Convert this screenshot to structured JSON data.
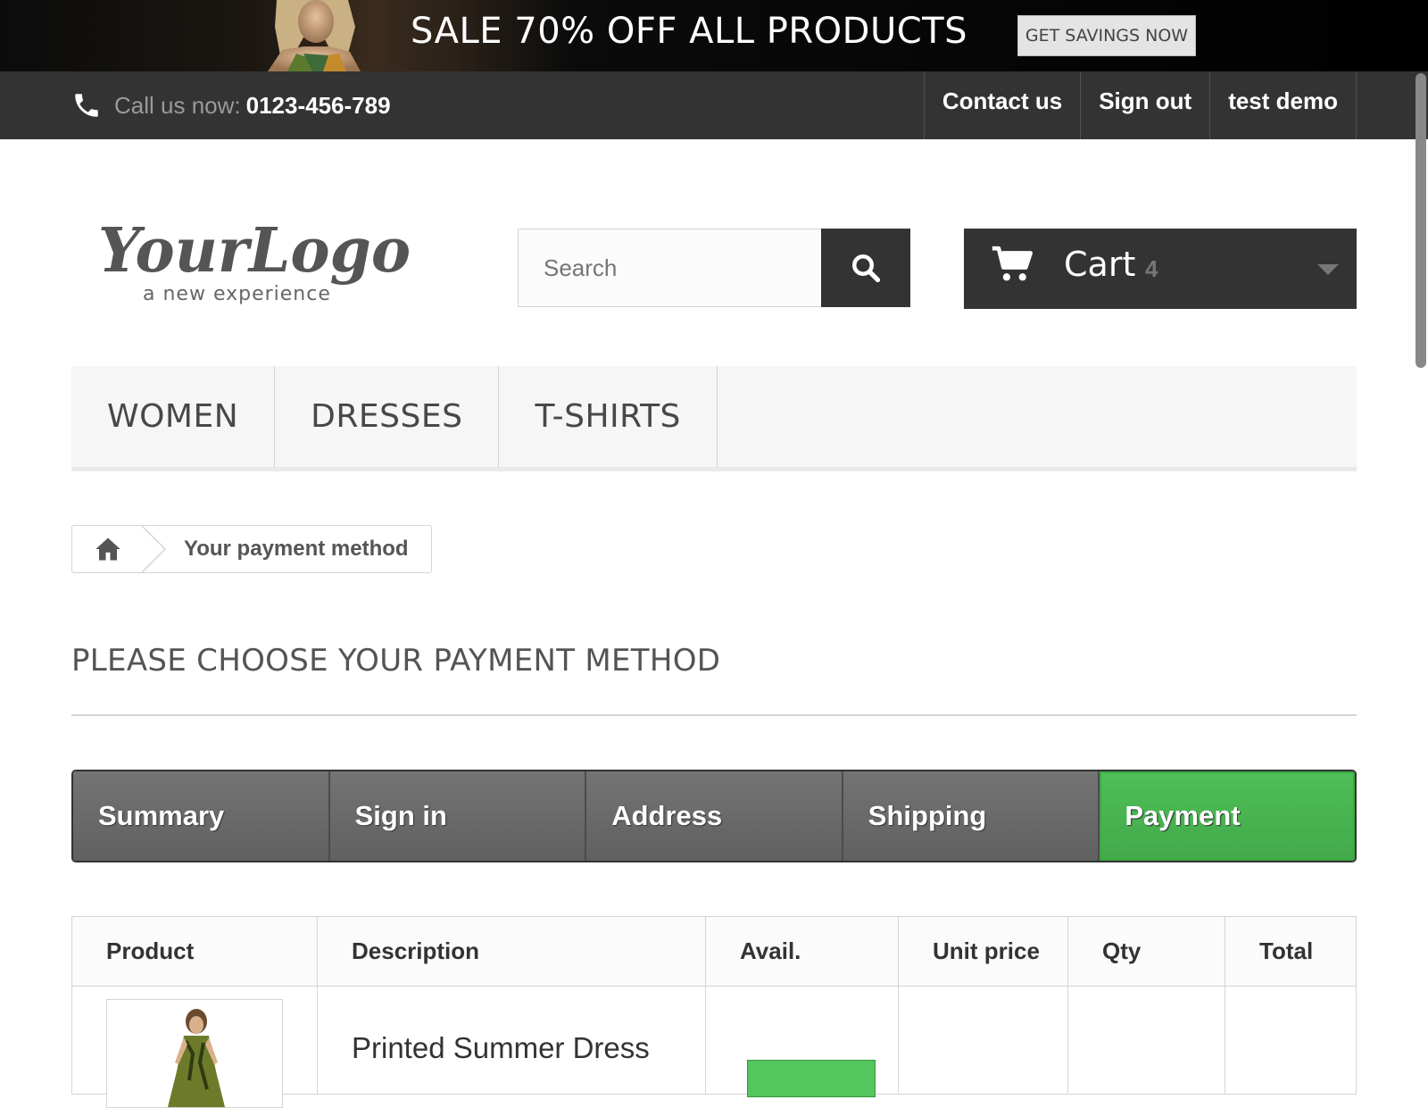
{
  "promo": {
    "headline": "SALE 70% OFF ALL PRODUCTS",
    "button_label": "GET SAVINGS NOW"
  },
  "topbar": {
    "phone_label": "Call us now:",
    "phone_number": "0123-456-789",
    "links": [
      "Contact us",
      "Sign out",
      "test demo"
    ]
  },
  "logo": {
    "main": "YourLogo",
    "tagline": "a new experience"
  },
  "search": {
    "placeholder": "Search"
  },
  "cart": {
    "label": "Cart",
    "count": "4"
  },
  "menu": {
    "items": [
      "WOMEN",
      "DRESSES",
      "T-SHIRTS"
    ]
  },
  "breadcrumb": {
    "current": "Your payment method"
  },
  "page_heading": "PLEASE CHOOSE YOUR PAYMENT METHOD",
  "steps": {
    "items": [
      "Summary",
      "Sign in",
      "Address",
      "Shipping",
      "Payment"
    ],
    "active": "Payment"
  },
  "table": {
    "headers": [
      "Product",
      "Description",
      "Avail.",
      "Unit price",
      "Qty",
      "Total"
    ],
    "rows": [
      {
        "description": "Printed Summer Dress"
      }
    ]
  },
  "colors": {
    "promo_bg": "#000000",
    "topbar_bg": "#333333",
    "active_step": "#45b14d",
    "step_bg": "#6a6a6a",
    "in_stock": "#55c65e"
  },
  "icons": [
    "phone-icon",
    "search-icon",
    "cart-icon",
    "caret-down-icon",
    "home-icon"
  ]
}
